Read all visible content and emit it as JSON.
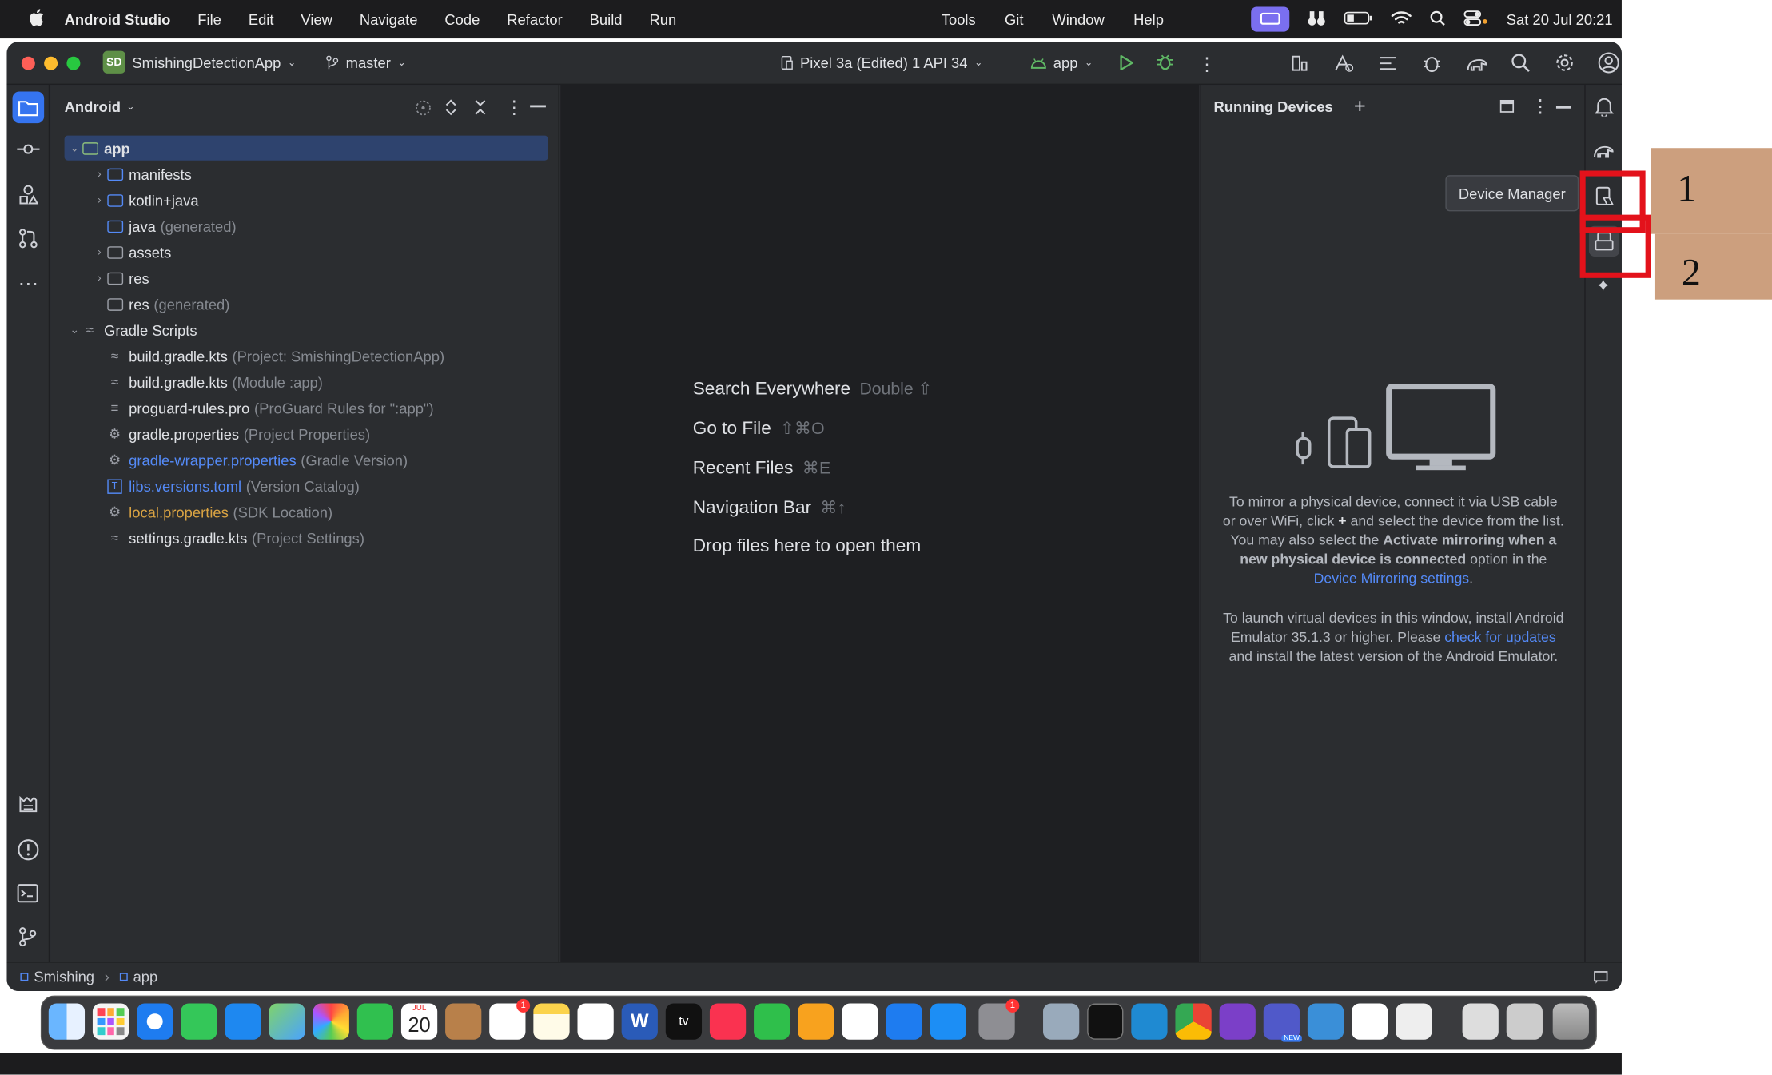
{
  "menubar": {
    "apple": "",
    "app": "Android Studio",
    "items": [
      "File",
      "Edit",
      "View",
      "Navigate",
      "Code",
      "Refactor",
      "Build",
      "Run",
      "Tools",
      "Git",
      "Window",
      "Help"
    ],
    "clock": "Sat 20 Jul  20:21"
  },
  "titlebar": {
    "project_badge": "SD",
    "project": "SmishingDetectionApp",
    "branch": "master",
    "device": "Pixel 3a (Edited) 1 API 34",
    "run_config": "app"
  },
  "project_panel": {
    "view": "Android",
    "rows": [
      {
        "name": "app",
        "hint": ""
      },
      {
        "name": "manifests",
        "hint": ""
      },
      {
        "name": "kotlin+java",
        "hint": ""
      },
      {
        "name": "java",
        "hint": "(generated)"
      },
      {
        "name": "assets",
        "hint": ""
      },
      {
        "name": "res",
        "hint": ""
      },
      {
        "name": "res",
        "hint": "(generated)"
      },
      {
        "name": "Gradle Scripts",
        "hint": ""
      },
      {
        "name": "build.gradle.kts",
        "hint": "(Project: SmishingDetectionApp)"
      },
      {
        "name": "build.gradle.kts",
        "hint": "(Module :app)"
      },
      {
        "name": "proguard-rules.pro",
        "hint": "(ProGuard Rules for \":app\")"
      },
      {
        "name": "gradle.properties",
        "hint": "(Project Properties)"
      },
      {
        "name": "gradle-wrapper.properties",
        "hint": "(Gradle Version)"
      },
      {
        "name": "libs.versions.toml",
        "hint": "(Version Catalog)"
      },
      {
        "name": "local.properties",
        "hint": "(SDK Location)"
      },
      {
        "name": "settings.gradle.kts",
        "hint": "(Project Settings)"
      }
    ]
  },
  "editor": {
    "lines": [
      {
        "label": "Search Everywhere",
        "shortcut": "Double ⇧"
      },
      {
        "label": "Go to File",
        "shortcut": "⇧⌘O"
      },
      {
        "label": "Recent Files",
        "shortcut": "⌘E"
      },
      {
        "label": "Navigation Bar",
        "shortcut": "⌘↑"
      },
      {
        "label": "Drop files here to open them",
        "shortcut": ""
      }
    ]
  },
  "running": {
    "title": "Running Devices",
    "p1a": "To mirror a physical device, connect it via USB cable or over WiFi, click ",
    "p1b": " and select the device from the list. You may also select the ",
    "p1bold": "Activate mirroring when a new physical device is connected",
    "p1c": " option in the ",
    "p1link": "Device Mirroring settings",
    "p1d": ".",
    "p2a": "To launch virtual devices in this window, install Android Emulator 35.1.3 or higher. Please ",
    "p2link": "check for updates",
    "p2b": " and install the latest version of the Android Emulator."
  },
  "tooltip": "Device Manager",
  "annotations": [
    "1",
    "2"
  ],
  "statusbar": {
    "crumb1": "Smishing",
    "crumb2": "app"
  },
  "dock": {
    "calendar_month": "JUL",
    "calendar_day": "20",
    "badge": "1",
    "teams_badge": "NEW"
  }
}
